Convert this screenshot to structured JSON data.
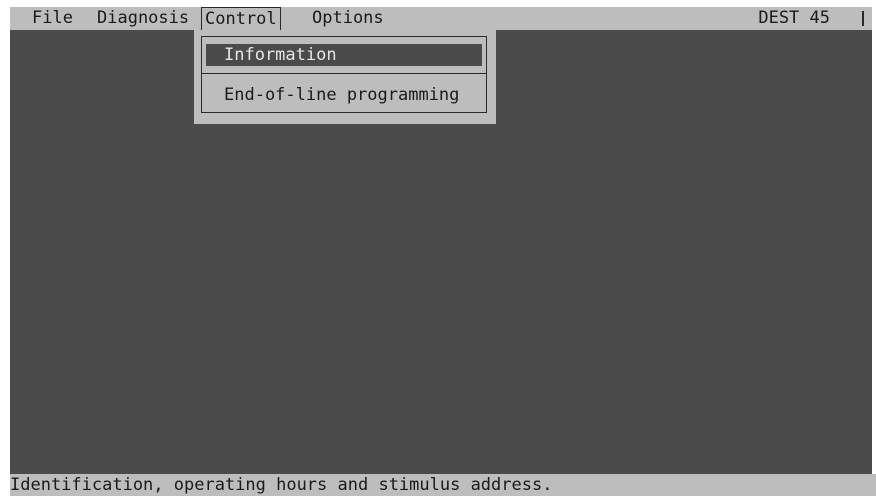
{
  "menubar": {
    "items": [
      {
        "label": "File"
      },
      {
        "label": "Diagnosis"
      },
      {
        "label": "Control"
      },
      {
        "label": "Options"
      }
    ],
    "active_index": 2,
    "device_label": "DEST 45"
  },
  "dropdown": {
    "options": [
      {
        "label": "Information",
        "selected": true
      },
      {
        "label": "End-of-line programming",
        "selected": false
      }
    ]
  },
  "statusbar": {
    "text": "Identification, operating hours and stimulus address."
  },
  "colors": {
    "background": "#4b4b4b",
    "bar": "#bdbdbd",
    "highlight": "#4b4b4b",
    "highlight_text": "#e6e6e6"
  }
}
